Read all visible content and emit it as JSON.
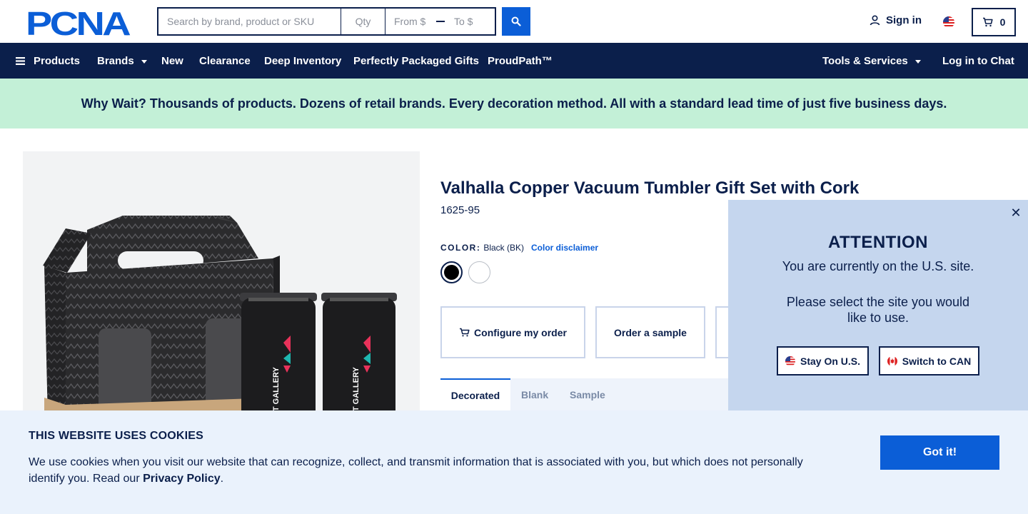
{
  "header": {
    "logo_text": "PCNA",
    "search": {
      "placeholder": "Search by brand, product or SKU",
      "qty_placeholder": "Qty",
      "from_placeholder": "From $",
      "to_placeholder": "To $"
    },
    "signin_label": "Sign in",
    "region_flag": "us-flag-icon",
    "cart_count": "0"
  },
  "nav": {
    "products": "Products",
    "brands": "Brands",
    "new": "New",
    "clearance": "Clearance",
    "deep_inventory": "Deep Inventory",
    "perfectly_packaged": "Perfectly Packaged Gifts",
    "proudpath": "ProudPath™",
    "tools_services": "Tools & Services",
    "chat": "Log in to Chat"
  },
  "promo": {
    "text": "Why Wait? Thousands of products. Dozens of retail brands. Every decoration method. All with a standard lead time of just five business days."
  },
  "product": {
    "title": "Valhalla Copper Vacuum Tumbler Gift Set with Cork",
    "sku": "1625-95",
    "color_label": "COLOR:",
    "color_value": "Black (BK)",
    "color_disclaimer": "Color disclaimer",
    "swatches": [
      "#000000",
      "#ffffff"
    ],
    "tumbler_text": "ART GALLERY",
    "actions": {
      "configure": "Configure my order",
      "sample": "Order a sample"
    },
    "tabs": [
      "Decorated",
      "Blank",
      "Sample"
    ]
  },
  "attention": {
    "title": "ATTENTION",
    "line1": "You are currently on the U.S. site.",
    "line2": "Please select the site you would like to use.",
    "stay_label": "Stay On U.S.",
    "switch_label": "Switch to CAN",
    "close_glyph": "✕"
  },
  "cookie": {
    "title": "THIS WEBSITE USES COOKIES",
    "text": "We use cookies when you visit our website that can recognize, collect, and transmit information that is associated with you, but which does not personally identify you. Read our ",
    "link": "Privacy Policy",
    "period": ".",
    "button": "Got it!"
  },
  "colors": {
    "navy": "#0b1f4b",
    "blue": "#0b5ed7",
    "promo_bg": "#c3f0d7",
    "popup_bg": "#c5d6ee",
    "cookie_bg": "#eaf2fc"
  }
}
